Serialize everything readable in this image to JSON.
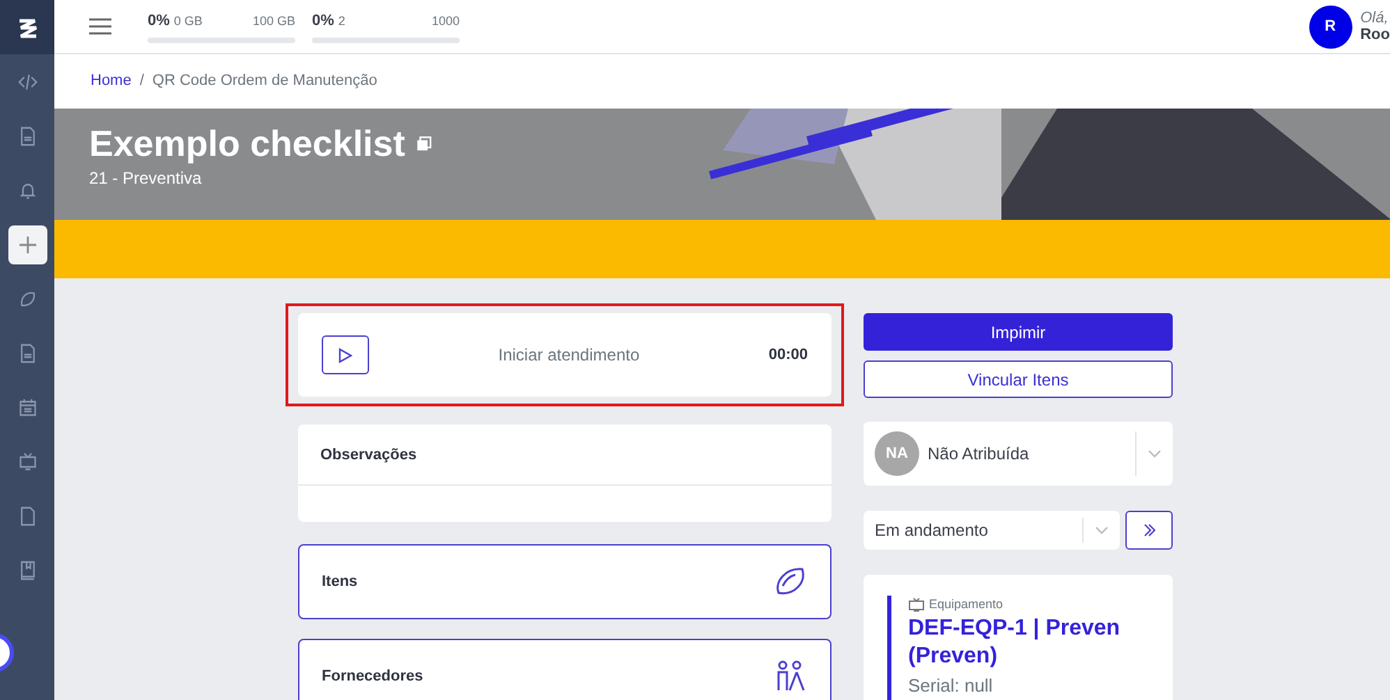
{
  "sidebar": {
    "items": [
      {
        "kind": "code",
        "selected": false
      },
      {
        "kind": "file-lines",
        "selected": false
      },
      {
        "kind": "bell",
        "selected": false
      },
      {
        "kind": "plus",
        "selected": true
      },
      {
        "kind": "leaf",
        "selected": false
      },
      {
        "kind": "file-lines",
        "selected": false
      },
      {
        "kind": "calendar",
        "selected": false
      },
      {
        "kind": "tv",
        "selected": false
      },
      {
        "kind": "file",
        "selected": false
      },
      {
        "kind": "book",
        "selected": false
      }
    ]
  },
  "topbar": {
    "usage_meters": [
      {
        "percent": "0%",
        "used": "0 GB",
        "total": "100 GB",
        "level": 0
      },
      {
        "percent": "0%",
        "used": "2",
        "total": "1000",
        "level": 0
      }
    ],
    "user": {
      "avatar_initial": "R",
      "greeting": "Olá,",
      "name": "Roo"
    }
  },
  "breadcrumb": {
    "separator": "/",
    "items": [
      {
        "label": "Home"
      },
      {
        "label": "QR Code Ordem de Manutenção"
      }
    ]
  },
  "banner": {
    "title": "Exemplo checklist",
    "subtitle": "21 - Preventiva"
  },
  "timer": {
    "label": "Iniciar atendimento",
    "time": "00:00",
    "highlighted": true
  },
  "notes": {
    "title": "Observações"
  },
  "sections": [
    {
      "title": "Itens",
      "kind": "items"
    },
    {
      "title": "Fornecedores",
      "kind": "suppliers"
    }
  ],
  "actions": [
    {
      "label": "Impimir",
      "kind": "primary"
    },
    {
      "label": "Vincular Itens",
      "kind": "outline"
    }
  ],
  "assignee": {
    "initials": "NA",
    "value": "Não Atribuída"
  },
  "status": {
    "value": "Em andamento"
  },
  "equipment": {
    "label": "Equipamento",
    "title": "DEF-EQP-1 | Preven (Preven)",
    "serial": "Serial: null"
  }
}
